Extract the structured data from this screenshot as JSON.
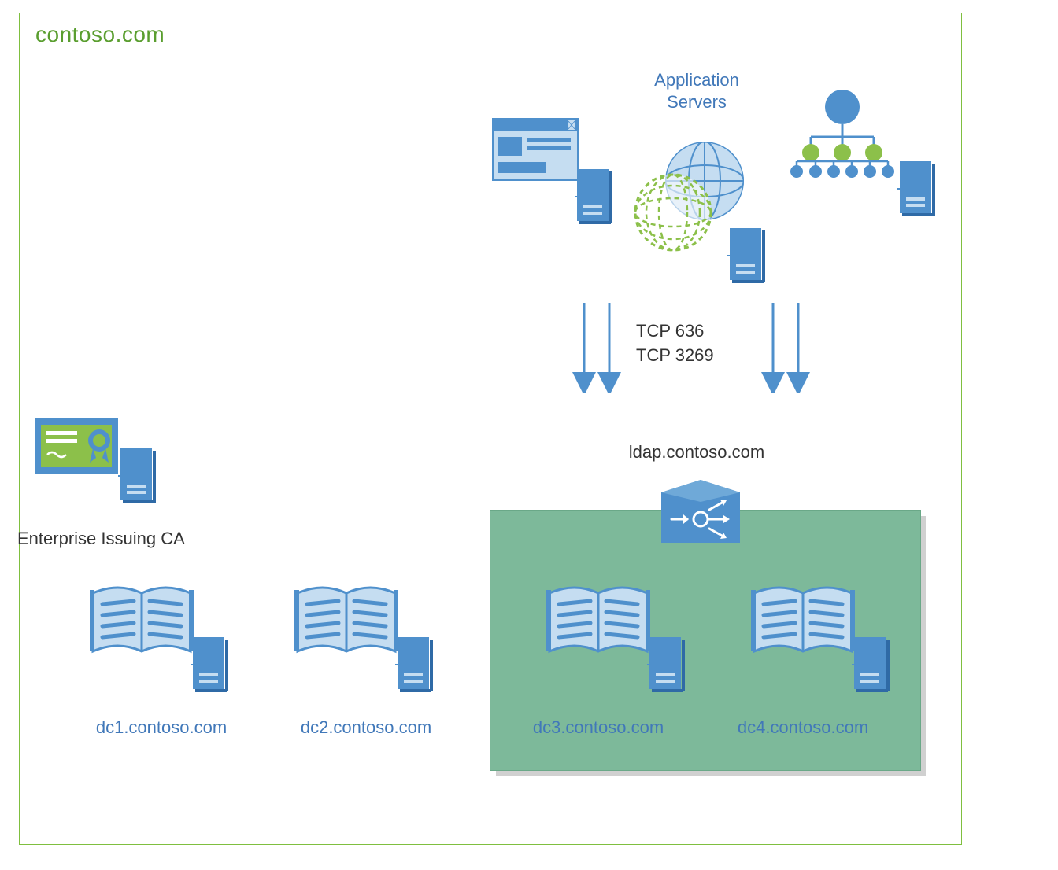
{
  "domain_title": "contoso.com",
  "appservers_title_l1": "Application",
  "appservers_title_l2": "Servers",
  "ports": {
    "l1": "TCP 636",
    "l2": "TCP 3269"
  },
  "ldap_label": "ldap.contoso.com",
  "ca_label": "Enterprise Issuing CA",
  "dcs": {
    "dc1": "dc1.contoso.com",
    "dc2": "dc2.contoso.com",
    "dc3": "dc3.contoso.com",
    "dc4": "dc4.contoso.com"
  },
  "colors": {
    "blue": "#4f90cc",
    "blue_dark": "#3b79b6",
    "blue_light": "#c5ddf1",
    "green": "#8cc04a",
    "green_dark": "#6aa33a",
    "box_green": "#7db99a"
  }
}
